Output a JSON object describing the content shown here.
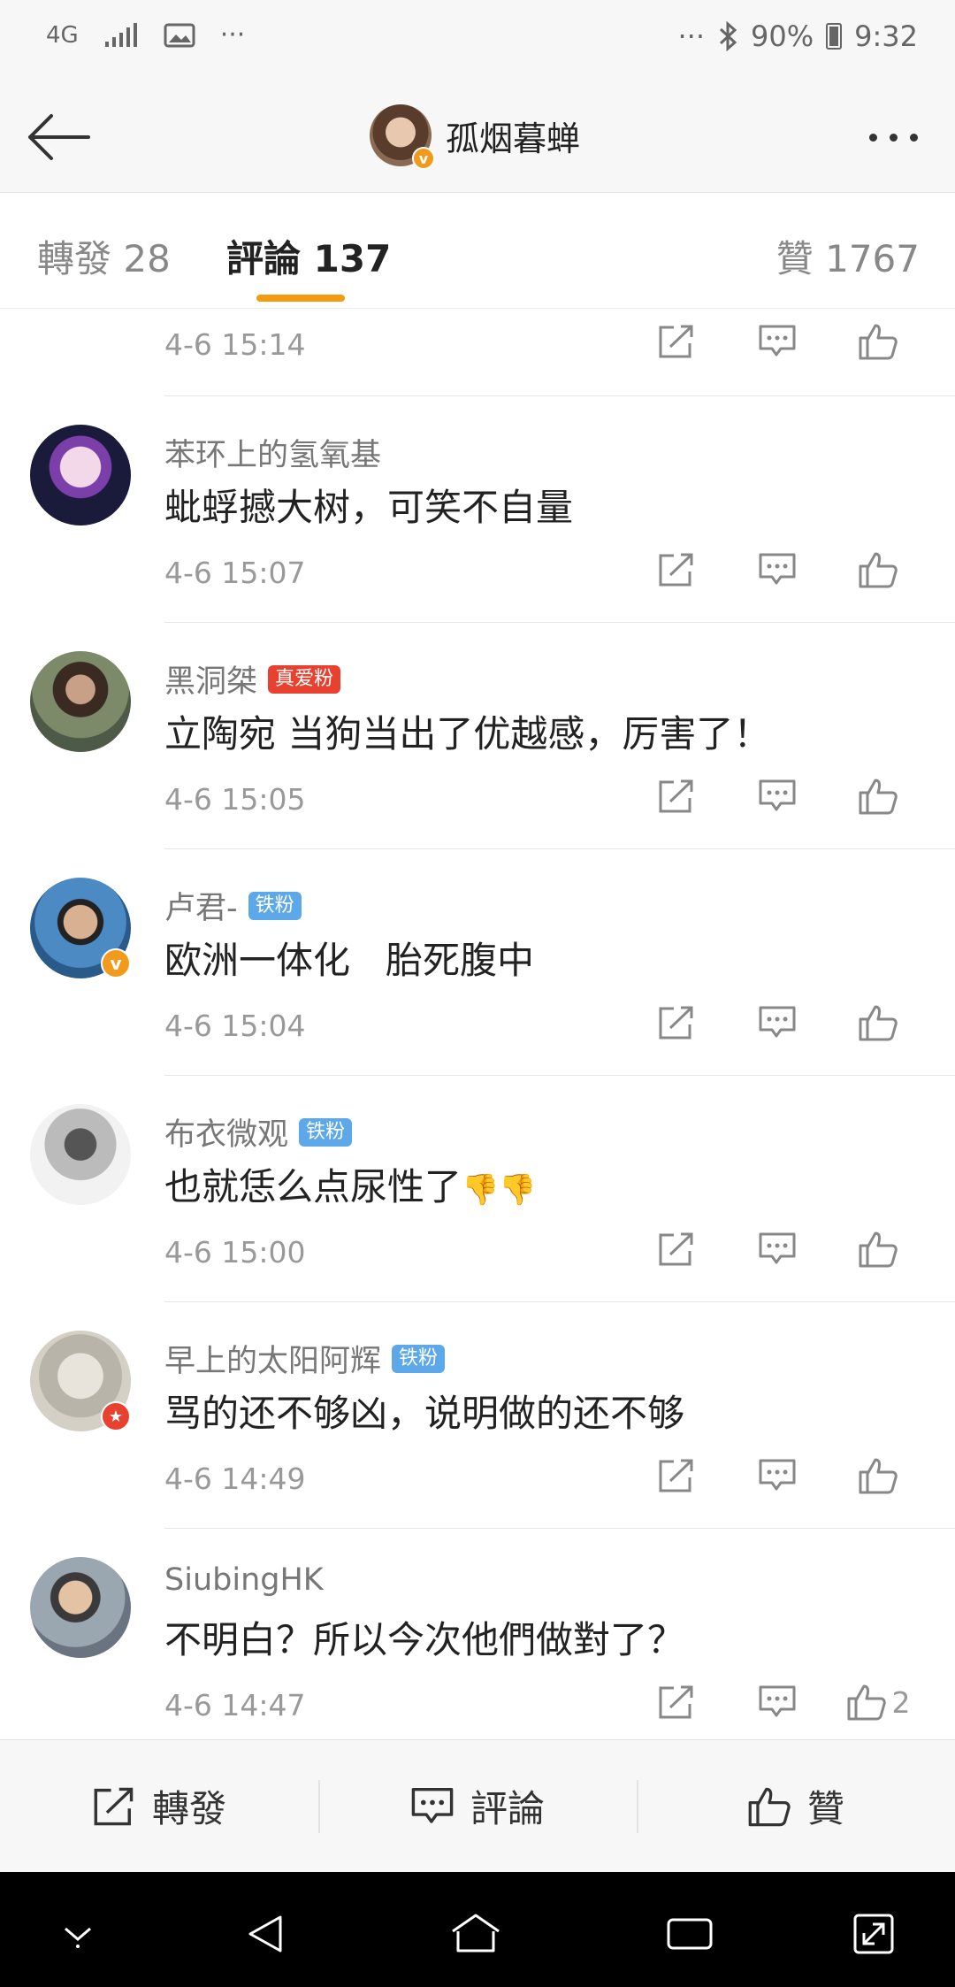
{
  "status_bar": {
    "network": "4G",
    "more": "···",
    "notif_more": "···",
    "battery": "90%",
    "time": "9:32"
  },
  "header": {
    "username": "孤烟暮蝉",
    "back_icon": "arrow-left-icon",
    "more_icon": "more-dots-icon"
  },
  "tabs": [
    {
      "label": "轉發 28"
    },
    {
      "label": "評論 137"
    },
    {
      "label": "贊 1767"
    }
  ],
  "comments": [
    {
      "time": "4-6 15:14"
    },
    {
      "name": "苯环上的氢氧基",
      "badge": "",
      "text": "蚍蜉撼大树，可笑不自量",
      "time": "4-6 15:07",
      "likes": ""
    },
    {
      "name": "黑洞桀",
      "badge": "真爱粉",
      "text": "立陶宛 当狗当出了优越感，厉害了！",
      "time": "4-6 15:05",
      "likes": ""
    },
    {
      "name": "卢君-",
      "badge": "铁粉",
      "text": "欧洲一体化   胎死腹中",
      "time": "4-6 15:04",
      "likes": ""
    },
    {
      "name": "布衣微观",
      "badge": "铁粉",
      "text": "也就恁么点尿性了",
      "time": "4-6 15:00",
      "likes": ""
    },
    {
      "name": "早上的太阳阿辉",
      "badge": "铁粉",
      "text": "骂的还不够凶，说明做的还不够",
      "time": "4-6 14:49",
      "likes": ""
    },
    {
      "name": "SiubingHK",
      "badge": "",
      "text": "不明白？所以今次他們做對了？",
      "time": "4-6 14:47",
      "likes": "2"
    }
  ],
  "bottom_bar": {
    "repost": "轉發",
    "comment": "評論",
    "like": "贊"
  },
  "colors": {
    "accent": "#f39c12",
    "fan_red": "#e8412f",
    "fan_blue": "#5ca8e8"
  }
}
